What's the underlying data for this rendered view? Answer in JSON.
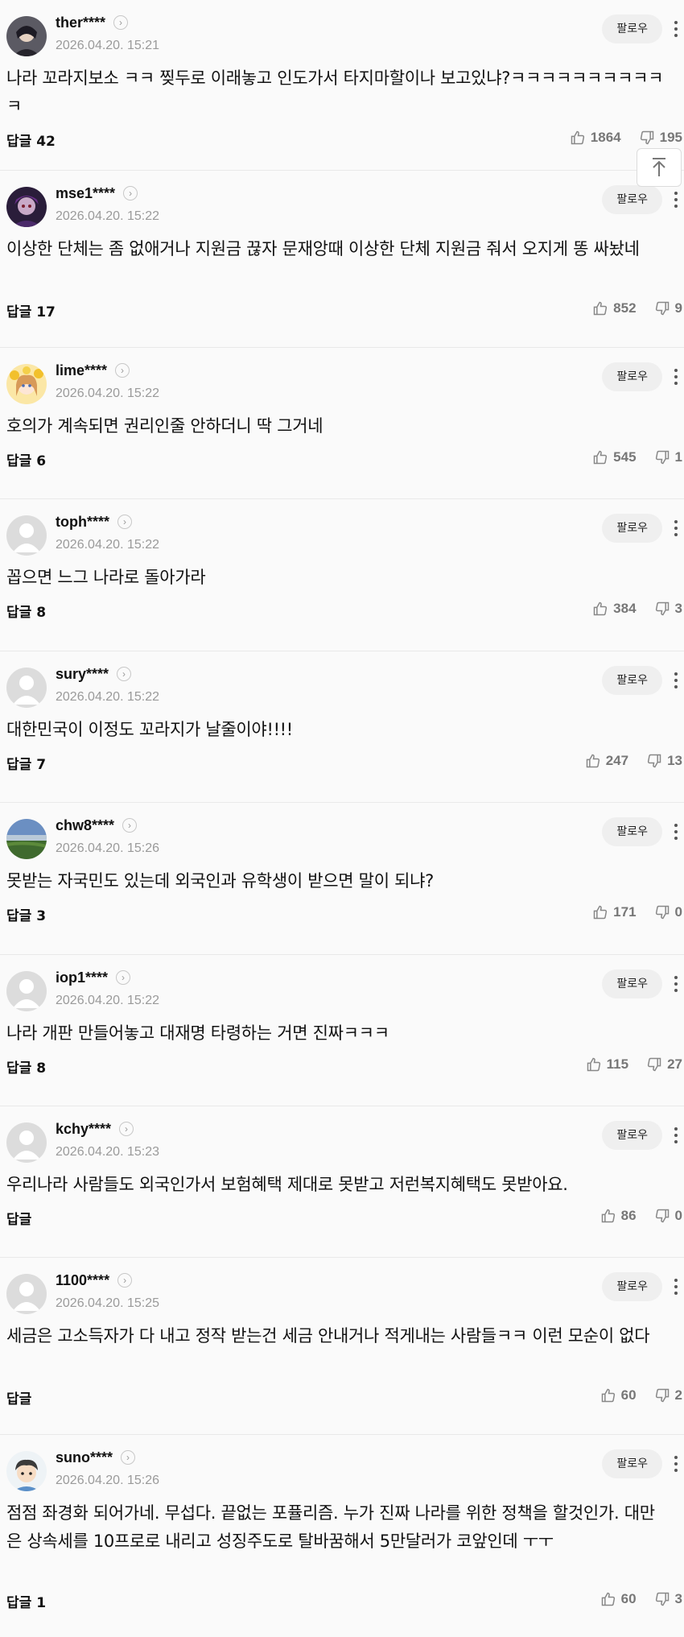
{
  "labels": {
    "follow": "팔로우"
  },
  "comments": [
    {
      "nick": "ther****",
      "date": "2026.04.20. 15:21",
      "text": "나라 꼬라지보소 ㅋㅋ 찢두로 이래놓고 인도가서 타지마할이나 보고있냐?ㅋㅋㅋㅋㅋㅋㅋㅋㅋㅋㅋ",
      "reply": "답글 42",
      "likes": "1864",
      "dislikes": "195",
      "avatar": "avatar-dark-character"
    },
    {
      "nick": "mse1****",
      "date": "2026.04.20. 15:22",
      "text": "이상한 단체는 좀 없애거나 지원금 끊자 문재앙때 이상한 단체 지원금 줘서 오지게 똥 싸놨네",
      "reply": "답글 17",
      "likes": "852",
      "dislikes": "9",
      "avatar": "avatar-purple-character"
    },
    {
      "nick": "lime****",
      "date": "2026.04.20. 15:22",
      "text": "호의가 계속되면 권리인줄 안하더니 딱 그거네",
      "reply": "답글 6",
      "likes": "545",
      "dislikes": "1",
      "avatar": "avatar-flower-girl"
    },
    {
      "nick": "toph****",
      "date": "2026.04.20. 15:22",
      "text": "꼽으면 느그 나라로 돌아가라",
      "reply": "답글 8",
      "likes": "384",
      "dislikes": "3",
      "avatar": "avatar-default"
    },
    {
      "nick": "sury****",
      "date": "2026.04.20. 15:22",
      "text": "대한민국이 이정도 꼬라지가 날줄이야!!!!",
      "reply": "답글 7",
      "likes": "247",
      "dislikes": "13",
      "avatar": "avatar-default"
    },
    {
      "nick": "chw8****",
      "date": "2026.04.20. 15:26",
      "text": "못받는 자국민도 있는데 외국인과 유학생이 받으면 말이 되냐?",
      "reply": "답글 3",
      "likes": "171",
      "dislikes": "0",
      "avatar": "avatar-landscape"
    },
    {
      "nick": "iop1****",
      "date": "2026.04.20. 15:22",
      "text": "나라 개판 만들어놓고 대재명 타령하는 거면 진짜ㅋㅋㅋ",
      "reply": "답글 8",
      "likes": "115",
      "dislikes": "27",
      "avatar": "avatar-default"
    },
    {
      "nick": "kchy****",
      "date": "2026.04.20. 15:23",
      "text": "우리나라 사람들도 외국인가서 보험혜택 제대로 못받고 저런복지혜택도 못받아요.",
      "reply": "답글",
      "likes": "86",
      "dislikes": "0",
      "avatar": "avatar-default"
    },
    {
      "nick": "1100****",
      "date": "2026.04.20. 15:25",
      "text": "세금은 고소득자가 다 내고 정작 받는건 세금 안내거나 적게내는 사람들ㅋㅋ 이런 모순이 없다",
      "reply": "답글",
      "likes": "60",
      "dislikes": "2",
      "avatar": "avatar-default"
    },
    {
      "nick": "suno****",
      "date": "2026.04.20. 15:26",
      "text": "점점 좌경화 되어가네. 무섭다. 끝없는 포퓰리즘. 누가 진짜 나라를 위한 정책을 할것인가. 대만은 상속세를 10프로로 내리고 성징주도로 탈바꿈해서 5만달러가 코앞인데 ㅜㅜ",
      "reply": "답글 1",
      "likes": "60",
      "dislikes": "3",
      "avatar": "avatar-cartoon-boy"
    }
  ]
}
